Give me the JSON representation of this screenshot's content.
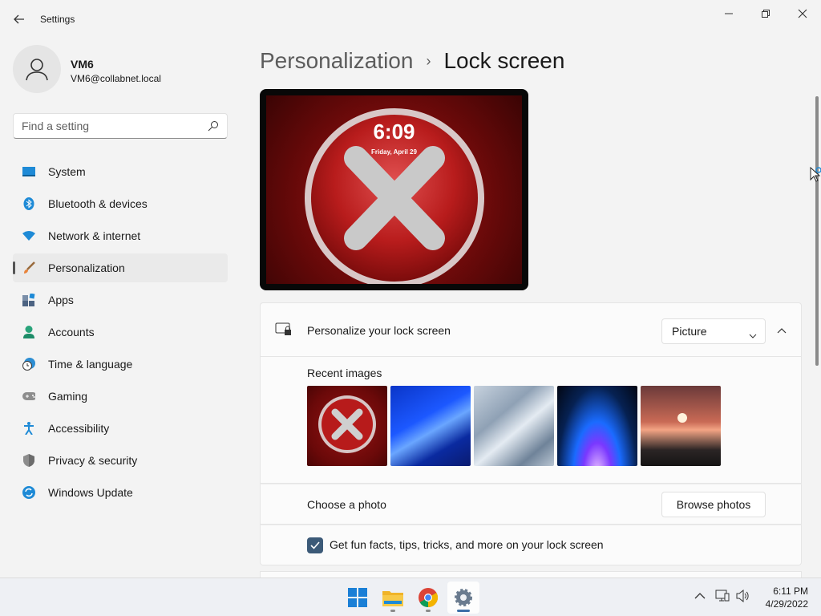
{
  "app": {
    "title": "Settings"
  },
  "user": {
    "name": "VM6",
    "email": "VM6@collabnet.local"
  },
  "search": {
    "placeholder": "Find a setting"
  },
  "sidebar": {
    "items": [
      {
        "label": "System",
        "icon": "system-icon"
      },
      {
        "label": "Bluetooth & devices",
        "icon": "bluetooth-icon"
      },
      {
        "label": "Network & internet",
        "icon": "wifi-icon"
      },
      {
        "label": "Personalization",
        "icon": "brush-icon",
        "active": true
      },
      {
        "label": "Apps",
        "icon": "apps-icon"
      },
      {
        "label": "Accounts",
        "icon": "person-icon"
      },
      {
        "label": "Time & language",
        "icon": "clock-globe-icon"
      },
      {
        "label": "Gaming",
        "icon": "gamepad-icon"
      },
      {
        "label": "Accessibility",
        "icon": "accessibility-icon"
      },
      {
        "label": "Privacy & security",
        "icon": "shield-icon"
      },
      {
        "label": "Windows Update",
        "icon": "update-icon"
      }
    ]
  },
  "breadcrumb": {
    "parent": "Personalization",
    "separator": "›",
    "current": "Lock screen"
  },
  "preview": {
    "time": "6:09",
    "date": "Friday, April 29"
  },
  "lockscreen": {
    "label": "Personalize your lock screen",
    "dropdown_value": "Picture",
    "recent_label": "Recent images",
    "choose_label": "Choose a photo",
    "browse_label": "Browse photos",
    "facts_label": "Get fun facts, tips, tricks, and more on your lock screen",
    "facts_checked": true
  },
  "taskbar": {
    "apps": [
      "windows-start-icon",
      "file-explorer-icon",
      "chrome-icon",
      "settings-icon"
    ],
    "time": "6:11 PM",
    "date": "4/29/2022"
  },
  "colors": {
    "accent": "#3c5a78",
    "active_nav": "#eaeaea",
    "background": "#f3f3f3"
  }
}
